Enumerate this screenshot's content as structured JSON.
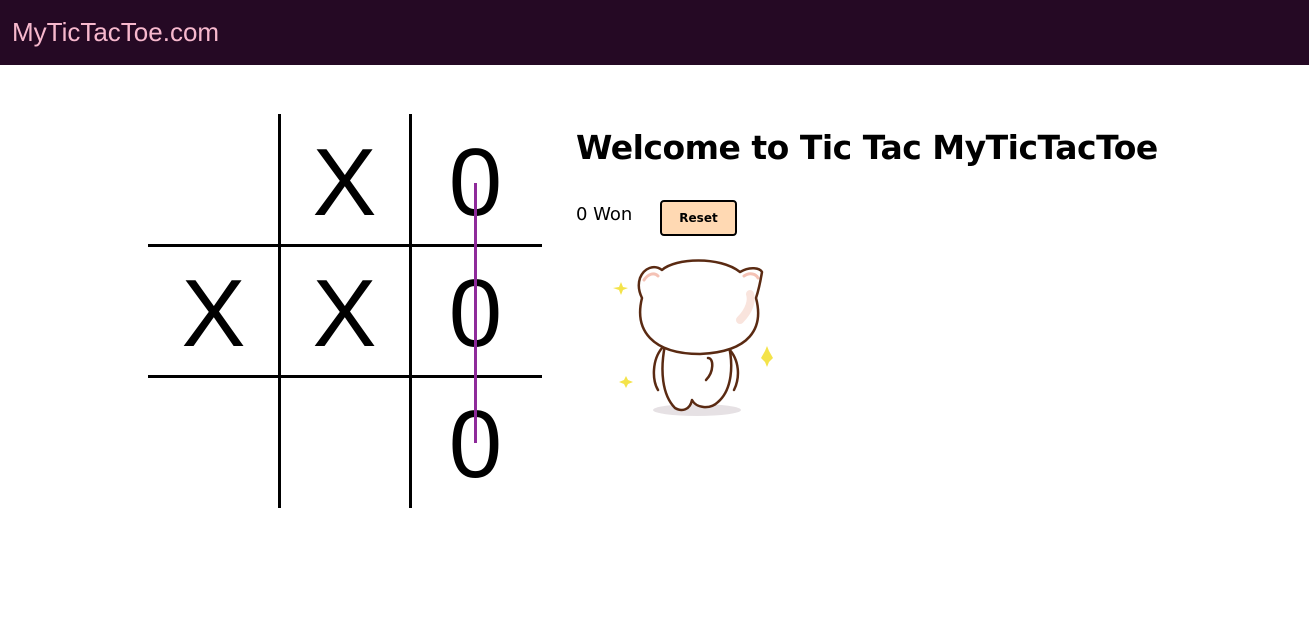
{
  "navbar": {
    "brand": "MyTicTacToe.com"
  },
  "board": {
    "cells": [
      "",
      "X",
      "0",
      "X",
      "X",
      "0",
      "",
      "",
      "0"
    ],
    "winning_line": "column-3",
    "colors": {
      "lines": "#000000",
      "win_line": "#8e2a9a"
    }
  },
  "panel": {
    "title": "Welcome to Tic Tac MyTicTacToe",
    "score": "0 Won",
    "reset_label": "Reset",
    "reset_color": "#ffd9b3"
  },
  "mascot": {
    "icon": "cat-mascot-icon"
  },
  "colors": {
    "navbar_bg": "#250924",
    "brand_text": "#f7b8cd"
  }
}
